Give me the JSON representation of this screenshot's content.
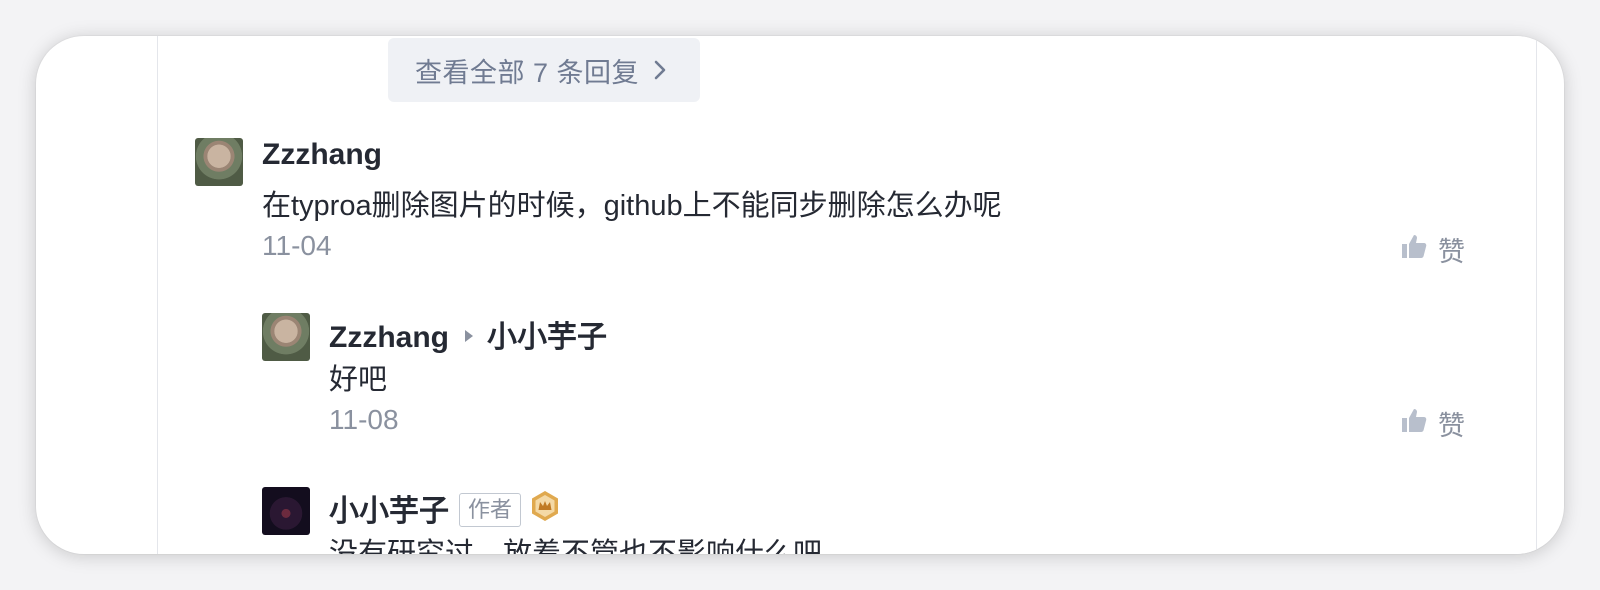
{
  "view_all_replies": {
    "label": "查看全部 7 条回复"
  },
  "comments": [
    {
      "author": "Zzzhang",
      "text": "在typroa删除图片的时候，github上不能同步删除怎么办呢",
      "date": "11-04",
      "like_label": "赞",
      "avatar": "user-avatar-photo"
    },
    {
      "author": "Zzzhang",
      "reply_to": "小小芋子",
      "text": "好吧",
      "date": "11-08",
      "like_label": "赞",
      "avatar": "user-avatar-photo"
    },
    {
      "author": "小小芋子",
      "author_tag": "作者",
      "badge": "crown-badge-icon",
      "text": "没有研究过，放着不管也不影响什么吧",
      "avatar": "user-avatar-dark"
    }
  ],
  "colors": {
    "accent_text": "#707b92",
    "button_bg": "#eff1f5",
    "name_text": "#252933",
    "meta_text": "#8a919f",
    "badge_gold": "#e0a94f"
  }
}
